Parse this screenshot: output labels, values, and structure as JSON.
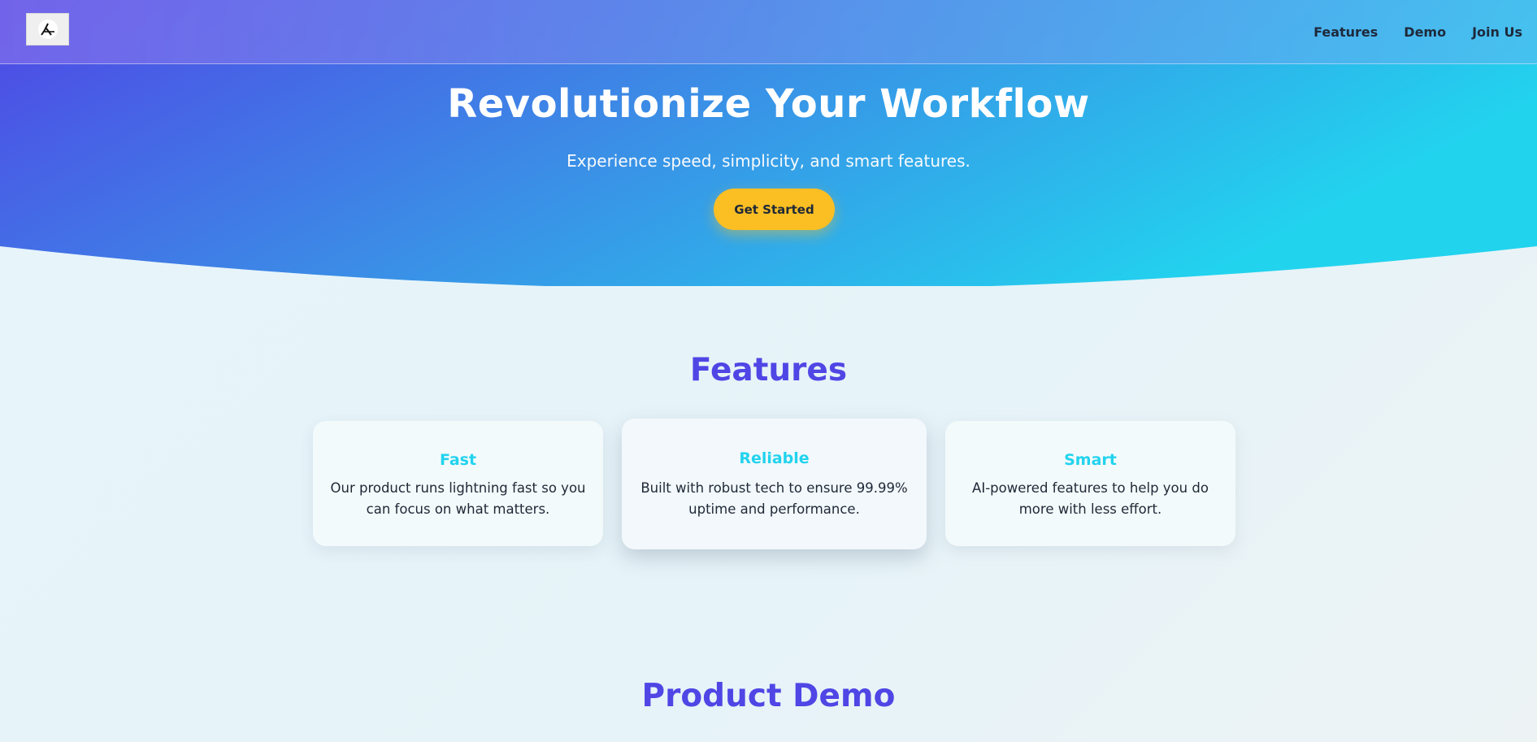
{
  "navbar": {
    "logo_icon": "logo-mark-icon",
    "links": [
      "Features",
      "Demo",
      "Join Us"
    ]
  },
  "hero": {
    "title": "Revolutionize Your Workflow",
    "subtitle": "Experience speed, simplicity, and smart features.",
    "cta_label": "Get Started"
  },
  "features": {
    "title": "Features",
    "cards": [
      {
        "title": "Fast",
        "description": "Our product runs lightning fast so you can focus on what matters."
      },
      {
        "title": "Reliable",
        "description": "Built with robust tech to ensure 99.99% uptime and performance."
      },
      {
        "title": "Smart",
        "description": "AI-powered features to help you do more with less effort."
      }
    ]
  },
  "demo": {
    "title": "Product Demo"
  },
  "colors": {
    "hero_gradient_start": "#4f46e5",
    "hero_gradient_end": "#22d3ee",
    "accent": "#4f46e5",
    "card_title": "#22d3ee",
    "cta": "#fbbf24"
  }
}
